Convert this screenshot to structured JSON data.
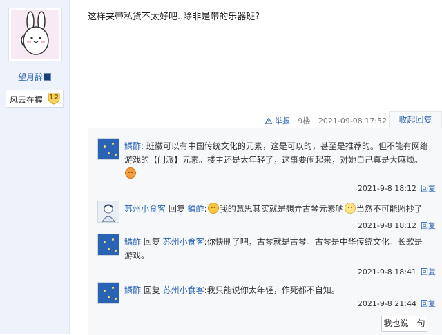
{
  "user": {
    "name": "望月辞",
    "rank_title": "风云在握",
    "rank_level": "12"
  },
  "post": {
    "content": "这样夹带私货不太好吧..除非是带的乐器班?",
    "report_label": "举报",
    "floor": "9楼",
    "time": "2021-09-08 17:52",
    "collapse_label": "收起回复"
  },
  "replies": [
    {
      "author": "鳞酢",
      "parts": [
        {
          "t": "text",
          "v": ": 班徽可以有中国传统文化的元素，这是可以的，甚至是推荐的。但不能有网络游戏的【门派】元素。楼主还是太年轻了，这事要闹起来，对她自己真是大麻烦。"
        },
        {
          "t": "emoji",
          "v": "sigh-emoji"
        }
      ],
      "time": "2021-9-8 18:12",
      "reply_label": "回复"
    },
    {
      "author": "苏州小食客",
      "reply_to_word": "回复",
      "reply_to": "鳞酢",
      "parts": [
        {
          "t": "text",
          "v": ":"
        },
        {
          "t": "emoji",
          "v": "smile-emoji"
        },
        {
          "t": "text",
          "v": "我的意思其实就是想弄古琴元素呐"
        },
        {
          "t": "emoji",
          "v": "star-emoji"
        },
        {
          "t": "text",
          "v": "当然不可能照抄了"
        }
      ],
      "time": "2021-9-8 18:12",
      "reply_label": "回复"
    },
    {
      "author": "鳞酢",
      "reply_to_word": "回复",
      "reply_to": "苏州小食客",
      "parts": [
        {
          "t": "text",
          "v": ":你快删了吧，古琴就是古琴。古琴是中华传统文化。长歌是游戏。"
        }
      ],
      "time": "2021-9-8 18:41",
      "reply_label": "回复"
    },
    {
      "author": "鳞酢",
      "reply_to_word": "回复",
      "reply_to": "苏州小食客",
      "parts": [
        {
          "t": "text",
          "v": ":我只能说你太年轻，作死都不自知。"
        }
      ],
      "time": "2021-9-8 21:44",
      "reply_label": "回复"
    }
  ],
  "say_button": "我也说一句",
  "colors": {
    "link": "#2d64b3",
    "panel_bg": "#f7f8fa",
    "sidebar_bg": "#eef3fb"
  }
}
